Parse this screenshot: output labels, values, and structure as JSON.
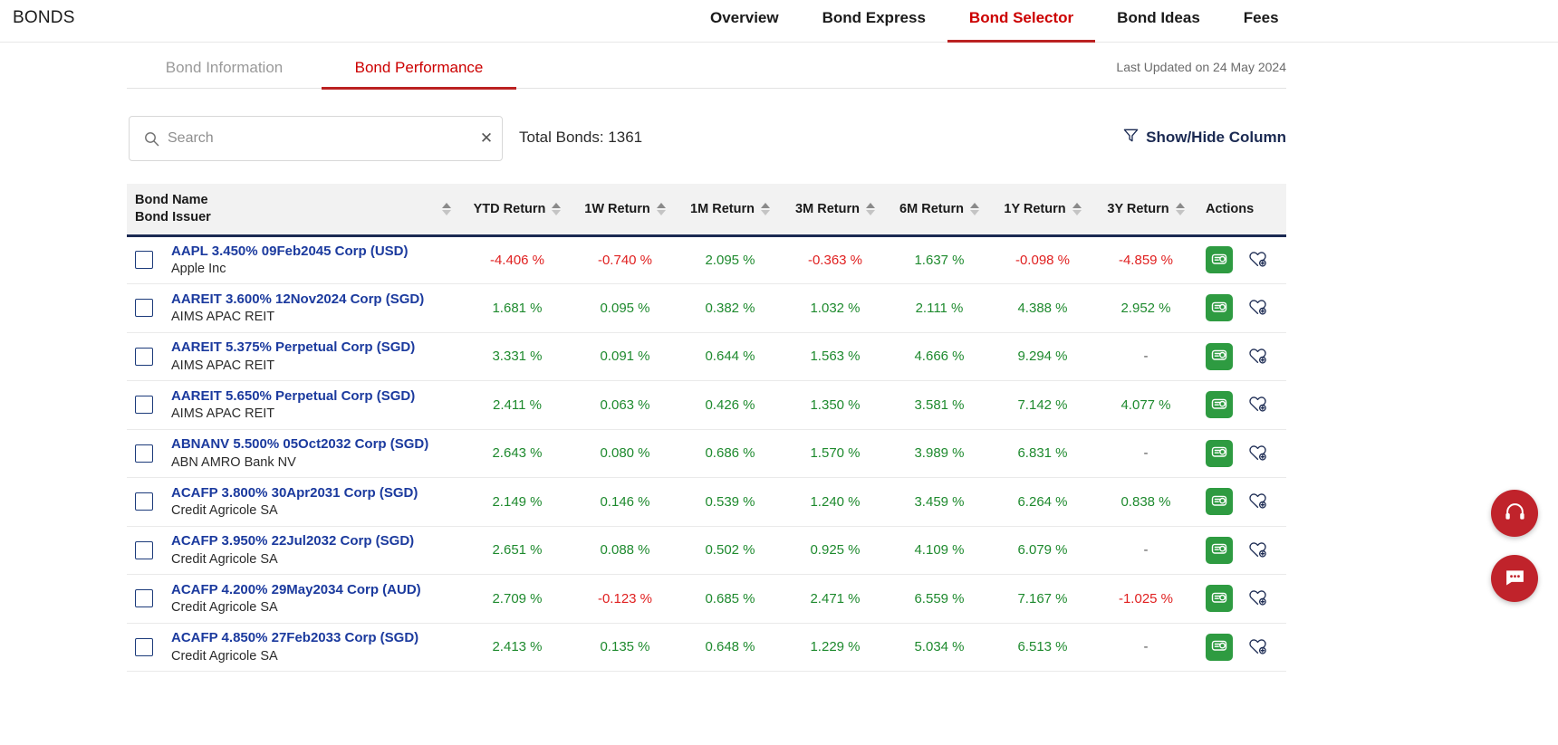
{
  "app": {
    "brand": "BONDS"
  },
  "topnav": [
    {
      "label": "Overview",
      "active": false
    },
    {
      "label": "Bond Express",
      "active": false
    },
    {
      "label": "Bond Selector",
      "active": true
    },
    {
      "label": "Bond Ideas",
      "active": false
    },
    {
      "label": "Fees",
      "active": false
    }
  ],
  "subtabs": [
    {
      "label": "Bond Information",
      "active": false
    },
    {
      "label": "Bond Performance",
      "active": true
    }
  ],
  "last_updated": "Last Updated on 24 May 2024",
  "toolbar": {
    "search_placeholder": "Search",
    "search_value": "",
    "search_clear_label": "✕",
    "total_bonds": "Total Bonds: 1361",
    "show_hide_column": "Show/Hide Column"
  },
  "table": {
    "headers": {
      "name_line1": "Bond Name",
      "name_line2": "Bond Issuer",
      "ytd": "YTD Return",
      "w1": "1W Return",
      "m1": "1M Return",
      "m3": "3M Return",
      "m6": "6M Return",
      "y1": "1Y Return",
      "y3": "3Y Return",
      "actions": "Actions"
    },
    "rows": [
      {
        "name": "AAPL 3.450% 09Feb2045 Corp (USD)",
        "issuer": "Apple Inc",
        "ytd": "-4.406 %",
        "w1": "-0.740 %",
        "m1": "2.095 %",
        "m3": "-0.363 %",
        "m6": "1.637 %",
        "y1": "-0.098 %",
        "y3": "-4.859 %"
      },
      {
        "name": "AAREIT 3.600% 12Nov2024 Corp (SGD)",
        "issuer": "AIMS APAC REIT",
        "ytd": "1.681 %",
        "w1": "0.095 %",
        "m1": "0.382 %",
        "m3": "1.032 %",
        "m6": "2.111 %",
        "y1": "4.388 %",
        "y3": "2.952 %"
      },
      {
        "name": "AAREIT 5.375% Perpetual Corp (SGD)",
        "issuer": "AIMS APAC REIT",
        "ytd": "3.331 %",
        "w1": "0.091 %",
        "m1": "0.644 %",
        "m3": "1.563 %",
        "m6": "4.666 %",
        "y1": "9.294 %",
        "y3": "-"
      },
      {
        "name": "AAREIT 5.650% Perpetual Corp (SGD)",
        "issuer": "AIMS APAC REIT",
        "ytd": "2.411 %",
        "w1": "0.063 %",
        "m1": "0.426 %",
        "m3": "1.350 %",
        "m6": "3.581 %",
        "y1": "7.142 %",
        "y3": "4.077 %"
      },
      {
        "name": "ABNANV 5.500% 05Oct2032 Corp (SGD)",
        "issuer": "ABN AMRO Bank NV",
        "ytd": "2.643 %",
        "w1": "0.080 %",
        "m1": "0.686 %",
        "m3": "1.570 %",
        "m6": "3.989 %",
        "y1": "6.831 %",
        "y3": "-"
      },
      {
        "name": "ACAFP 3.800% 30Apr2031 Corp (SGD)",
        "issuer": "Credit Agricole SA",
        "ytd": "2.149 %",
        "w1": "0.146 %",
        "m1": "0.539 %",
        "m3": "1.240 %",
        "m6": "3.459 %",
        "y1": "6.264 %",
        "y3": "0.838 %"
      },
      {
        "name": "ACAFP 3.950% 22Jul2032 Corp (SGD)",
        "issuer": "Credit Agricole SA",
        "ytd": "2.651 %",
        "w1": "0.088 %",
        "m1": "0.502 %",
        "m3": "0.925 %",
        "m6": "4.109 %",
        "y1": "6.079 %",
        "y3": "-"
      },
      {
        "name": "ACAFP 4.200% 29May2034 Corp (AUD)",
        "issuer": "Credit Agricole SA",
        "ytd": "2.709 %",
        "w1": "-0.123 %",
        "m1": "0.685 %",
        "m3": "2.471 %",
        "m6": "6.559 %",
        "y1": "7.167 %",
        "y3": "-1.025 %"
      },
      {
        "name": "ACAFP 4.850% 27Feb2033 Corp (SGD)",
        "issuer": "Credit Agricole SA",
        "ytd": "2.413 %",
        "w1": "0.135 %",
        "m1": "0.648 %",
        "m3": "1.229 %",
        "m6": "5.034 %",
        "y1": "6.513 %",
        "y3": "-"
      }
    ]
  },
  "icons": {
    "search": "search-icon",
    "clear": "close-icon",
    "filter": "funnel-icon",
    "sort": "sort-arrows-icon",
    "trade": "banknote-icon",
    "favorite": "heart-plus-icon",
    "support": "headset-icon",
    "chat": "chat-bubble-icon"
  },
  "colors": {
    "accent_red": "#cc0000",
    "brand_navy": "#1b2a52",
    "link_blue": "#1b3a9e",
    "positive_green": "#1e8a2e",
    "negative_red": "#e02020",
    "trade_green": "#2e9b41",
    "fab_red": "#c0232b"
  }
}
